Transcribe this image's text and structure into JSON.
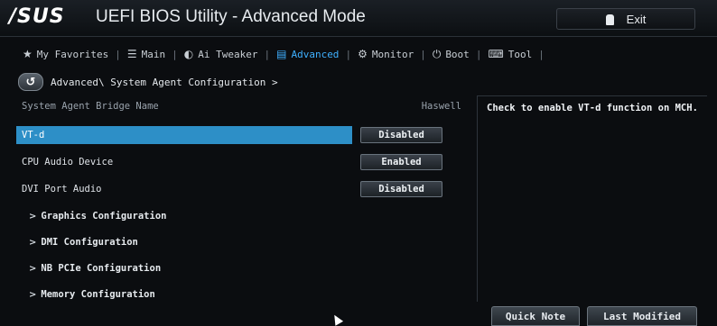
{
  "header": {
    "brand": "/SUS",
    "title": "UEFI BIOS Utility - Advanced Mode",
    "exit_label": "Exit",
    "exit_icon": "power-plug-icon"
  },
  "nav": {
    "items": [
      {
        "label": "My Favorites",
        "icon": "star-icon"
      },
      {
        "label": "Main",
        "icon": "list-icon"
      },
      {
        "label": "Ai Tweaker",
        "icon": "tweaker-icon"
      },
      {
        "label": "Advanced",
        "icon": "advanced-icon",
        "active": true
      },
      {
        "label": "Monitor",
        "icon": "monitor-icon"
      },
      {
        "label": "Boot",
        "icon": "power-icon"
      },
      {
        "label": "Tool",
        "icon": "tool-icon"
      }
    ],
    "accent_color": "#3fb0ff"
  },
  "breadcrumb": {
    "text": "Advanced\\ System Agent Configuration >"
  },
  "main": {
    "header_row": {
      "label": "System Agent Bridge Name",
      "value": "Haswell"
    },
    "settings": [
      {
        "label": "VT-d",
        "value": "Disabled",
        "selected": true
      },
      {
        "label": "CPU Audio Device",
        "value": "Enabled"
      },
      {
        "label": "DVI Port Audio",
        "value": "Disabled"
      }
    ],
    "submenus": [
      {
        "label": "Graphics Configuration"
      },
      {
        "label": "DMI Configuration"
      },
      {
        "label": "NB PCIe Configuration"
      },
      {
        "label": "Memory Configuration"
      }
    ],
    "selection_color": "#2d8fc7"
  },
  "help": {
    "text": "Check to enable VT-d function on MCH."
  },
  "footer": {
    "quick_note": "Quick Note",
    "last_modified": "Last Modified"
  }
}
